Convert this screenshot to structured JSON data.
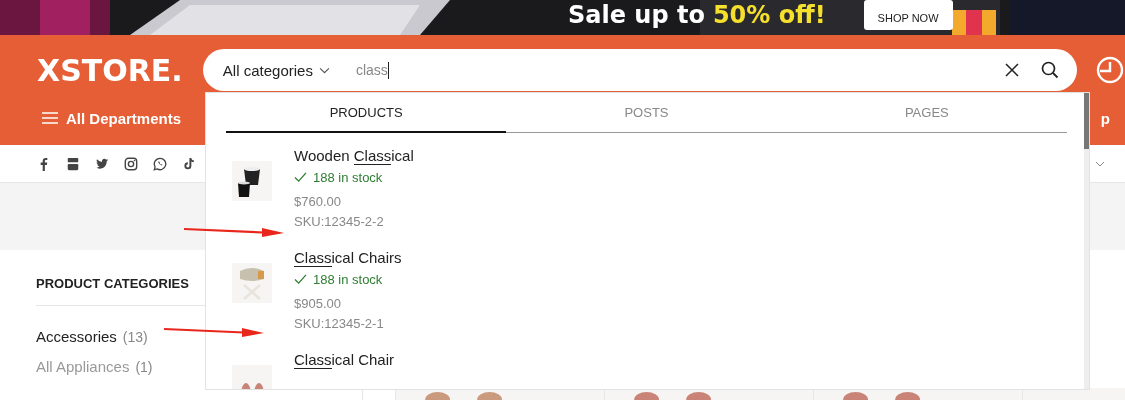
{
  "banner": {
    "headline": "Sale up to",
    "highlight": "50% off!",
    "button": "SHOP NOW"
  },
  "header": {
    "logo": "XSTORE.",
    "departments": "All Departments",
    "cut_menu_text": "p"
  },
  "search": {
    "category": "All categories",
    "value": "class"
  },
  "results": {
    "tabs": [
      {
        "label": "PRODUCTS",
        "selected": true
      },
      {
        "label": "POSTS",
        "selected": false
      },
      {
        "label": "PAGES",
        "selected": false
      }
    ],
    "products": [
      {
        "title": [
          {
            "text": "Wooden ",
            "highlighted": false
          },
          {
            "text": "Class",
            "highlighted": true
          },
          {
            "text": "ical",
            "highlighted": false
          }
        ],
        "stock": "188 in stock",
        "price": "$760.00",
        "sku": "SKU:12345-2-2"
      },
      {
        "title": [
          {
            "text": "Class",
            "highlighted": true
          },
          {
            "text": "ical Chairs",
            "highlighted": false
          }
        ],
        "stock": "188 in stock",
        "price": "$905.00",
        "sku": "SKU:12345-2-1"
      },
      {
        "title": [
          {
            "text": "Class",
            "highlighted": true
          },
          {
            "text": "ical Chair",
            "highlighted": false
          }
        ]
      }
    ]
  },
  "sidebar": {
    "title": "PRODUCT CATEGORIES",
    "categories": [
      {
        "name": "Accessories",
        "count": "(13)",
        "selected": true
      },
      {
        "name": "All Appliances",
        "count": "(1)",
        "selected": false
      }
    ]
  },
  "annotations": [
    {
      "kind": "arrow"
    },
    {
      "kind": "arrow"
    }
  ]
}
